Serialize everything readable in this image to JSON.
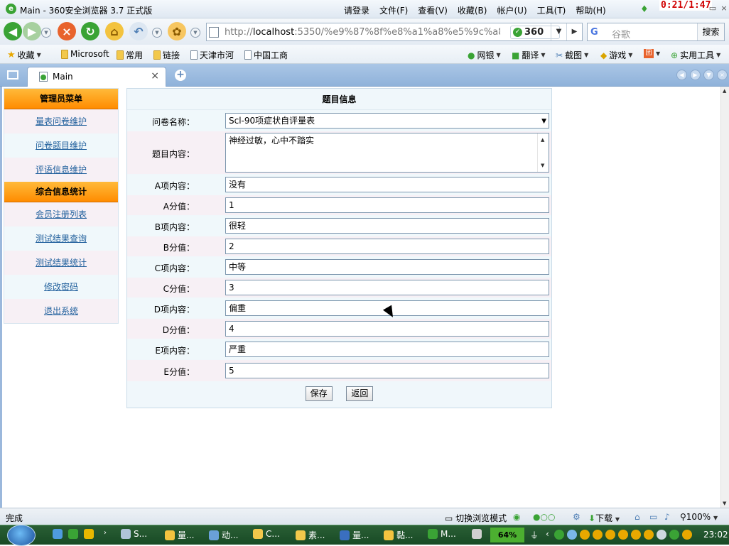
{
  "window": {
    "title": "Main - 360安全浏览器 3.7 正式版",
    "clock_overlay": "0:21/1:47",
    "menus": [
      "请登录",
      "文件(F)",
      "查看(V)",
      "收藏(B)",
      "帐户(U)",
      "工具(T)",
      "帮助(H)"
    ]
  },
  "nav": {
    "url_prefix": "http://",
    "url_host": "localhost",
    "url_rest": ":5350/%e9%87%8f%e8%a1%a8%e5%9c%a8",
    "badge": "360",
    "search_placeholder": "谷歌",
    "search_button": "搜索"
  },
  "bookmarks": {
    "favorites": "收藏",
    "items": [
      "Microsoft",
      "常用",
      "链接",
      "天津市河",
      "中国工商"
    ],
    "right_tools": [
      "网银",
      "翻译",
      "截图",
      "游戏",
      "团",
      "实用工具"
    ]
  },
  "tab": {
    "label": "Main"
  },
  "sidebar": {
    "section1": "管理员菜单",
    "items1": [
      "量表问卷维护",
      "问卷题目维护",
      "评语信息维护"
    ],
    "section2": "综合信息统计",
    "items2": [
      "会员注册列表",
      "测试结果查询",
      "测试结果统计",
      "修改密码",
      "退出系统"
    ]
  },
  "form": {
    "heading": "题目信息",
    "questionnaire_label": "问卷名称：",
    "questionnaire_value": "Scl-90项症状自评量表",
    "content_label": "题目内容：",
    "content_value": "神经过敏，心中不踏实",
    "rows": [
      {
        "label": "A项内容：",
        "value": "没有"
      },
      {
        "label": "A分值：",
        "value": "1"
      },
      {
        "label": "B项内容：",
        "value": "很轻"
      },
      {
        "label": "B分值：",
        "value": "2"
      },
      {
        "label": "C项内容：",
        "value": "中等"
      },
      {
        "label": "C分值：",
        "value": "3"
      },
      {
        "label": "D项内容：",
        "value": "偏重"
      },
      {
        "label": "D分值：",
        "value": "4"
      },
      {
        "label": "E项内容：",
        "value": "严重"
      },
      {
        "label": "E分值：",
        "value": "5"
      }
    ],
    "save": "保存",
    "back": "返回"
  },
  "status": {
    "done": "完成",
    "mode": "切换浏览模式",
    "download": "下载",
    "zoom": "100%"
  },
  "taskbar": {
    "tasks": [
      "S...",
      "量...",
      "动...",
      "C...",
      "素...",
      "量...",
      "黏...",
      "M..."
    ],
    "battery": "64%",
    "time": "23:02"
  }
}
